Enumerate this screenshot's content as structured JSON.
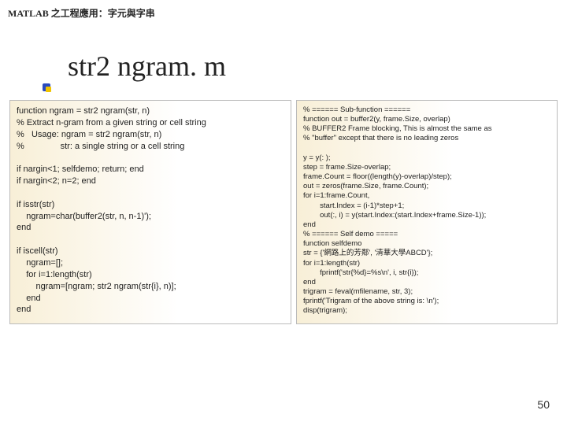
{
  "header": "MATLAB 之工程應用：字元與字串",
  "title": "str2 ngram. m",
  "left_code": "function ngram = str2 ngram(str, n)\n% Extract n-gram from a given string or cell string\n%   Usage: ngram = str2 ngram(str, n)\n%               str: a single string or a cell string\n\nif nargin<1; selfdemo; return; end\nif nargin<2; n=2; end\n\nif isstr(str)\n    ngram=char(buffer2(str, n, n-1)');\nend\n\nif iscell(str)\n    ngram=[];\n    for i=1:length(str)\n        ngram=[ngram; str2 ngram(str{i}, n)];\n    end\nend",
  "right_code": "% ====== Sub-function ======\nfunction out = buffer2(y, frame.Size, overlap)\n% BUFFER2 Frame blocking, This is almost the same as\n% \"buffer\" except that there is no leading zeros\n\ny = y(: );\nstep = frame.Size-overlap;\nframe.Count = floor((length(y)-overlap)/step);\nout = zeros(frame.Size, frame.Count);\nfor i=1:frame.Count,\n        start.Index = (i-1)*step+1;\n        out(:, i) = y(start.Index:(start.Index+frame.Size-1));\nend\n% ====== Self demo =====\nfunction selfdemo\nstr = {'網路上的芳鄰', '清華大學ABCD'};\nfor i=1:length(str)\n        fprintf('str{%d}=%s\\n', i, str{i});\nend\ntrigram = feval(mfilename, str, 3);\nfprintf('Trigram of the above string is: \\n');\ndisp(trigram);",
  "page_number": "50"
}
